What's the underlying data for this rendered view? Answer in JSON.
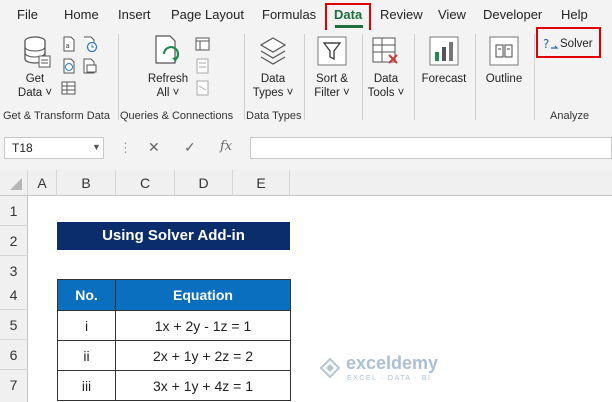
{
  "menu": {
    "tabs": [
      "File",
      "Home",
      "Insert",
      "Page Layout",
      "Formulas",
      "Data",
      "Review",
      "View",
      "Developer",
      "Help"
    ],
    "active_tab": "Data"
  },
  "ribbon": {
    "get_data": [
      "Get",
      "Data ˅"
    ],
    "refresh_all": [
      "Refresh",
      "All ˅"
    ],
    "data_types": [
      "Data",
      "Types ˅"
    ],
    "sort_filter": [
      "Sort &",
      "Filter ˅"
    ],
    "data_tools": [
      "Data",
      "Tools ˅"
    ],
    "forecast": "Forecast",
    "outline": "Outline",
    "solver": "Solver",
    "groups": [
      "Get & Transform Data",
      "Queries & Connections",
      "Data Types",
      "Analyze"
    ]
  },
  "formula_bar": {
    "name_box": "T18",
    "fx": "fx",
    "cancel": "✕",
    "enter": "✓",
    "content": ""
  },
  "sheet": {
    "columns": [
      "A",
      "B",
      "C",
      "D",
      "E"
    ],
    "rows": [
      "1",
      "2",
      "3",
      "4",
      "5",
      "6",
      "7"
    ],
    "title": "Using Solver Add-in",
    "table": {
      "headers": [
        "No.",
        "Equation"
      ],
      "rows": [
        [
          "i",
          "1x + 2y - 1z = 1"
        ],
        [
          "ii",
          "2x + 1y + 2z = 2"
        ],
        [
          "iii",
          "3x + 1y + 4z = 1"
        ]
      ]
    }
  },
  "watermark": {
    "name": "exceldemy",
    "tagline": "EXCEL · DATA · BI"
  },
  "colors": {
    "accent_green": "#1e6e3f",
    "title_fill": "#0b2d6b",
    "header_fill": "#0b6fbf",
    "highlight": "#e00000"
  }
}
